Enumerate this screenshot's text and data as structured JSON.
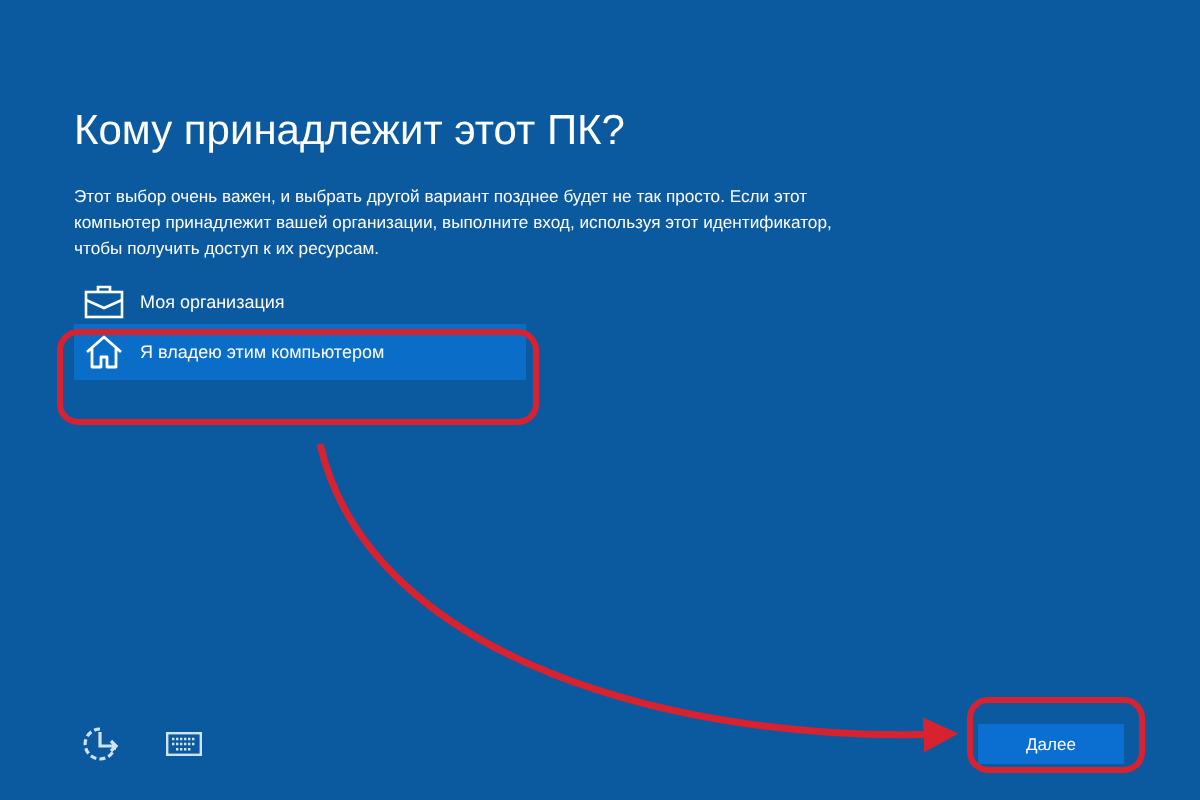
{
  "title": "Кому принадлежит этот ПК?",
  "description": "Этот выбор очень важен, и выбрать другой вариант позднее будет не так просто. Если этот компьютер принадлежит вашей организации, выполните вход, используя этот идентификатор, чтобы получить доступ к их ресурсам.",
  "options": [
    {
      "kind": "organization",
      "label": "Моя организация",
      "selected": false
    },
    {
      "kind": "personal",
      "label": "Я владею этим компьютером",
      "selected": true
    }
  ],
  "next_button": "Далее"
}
